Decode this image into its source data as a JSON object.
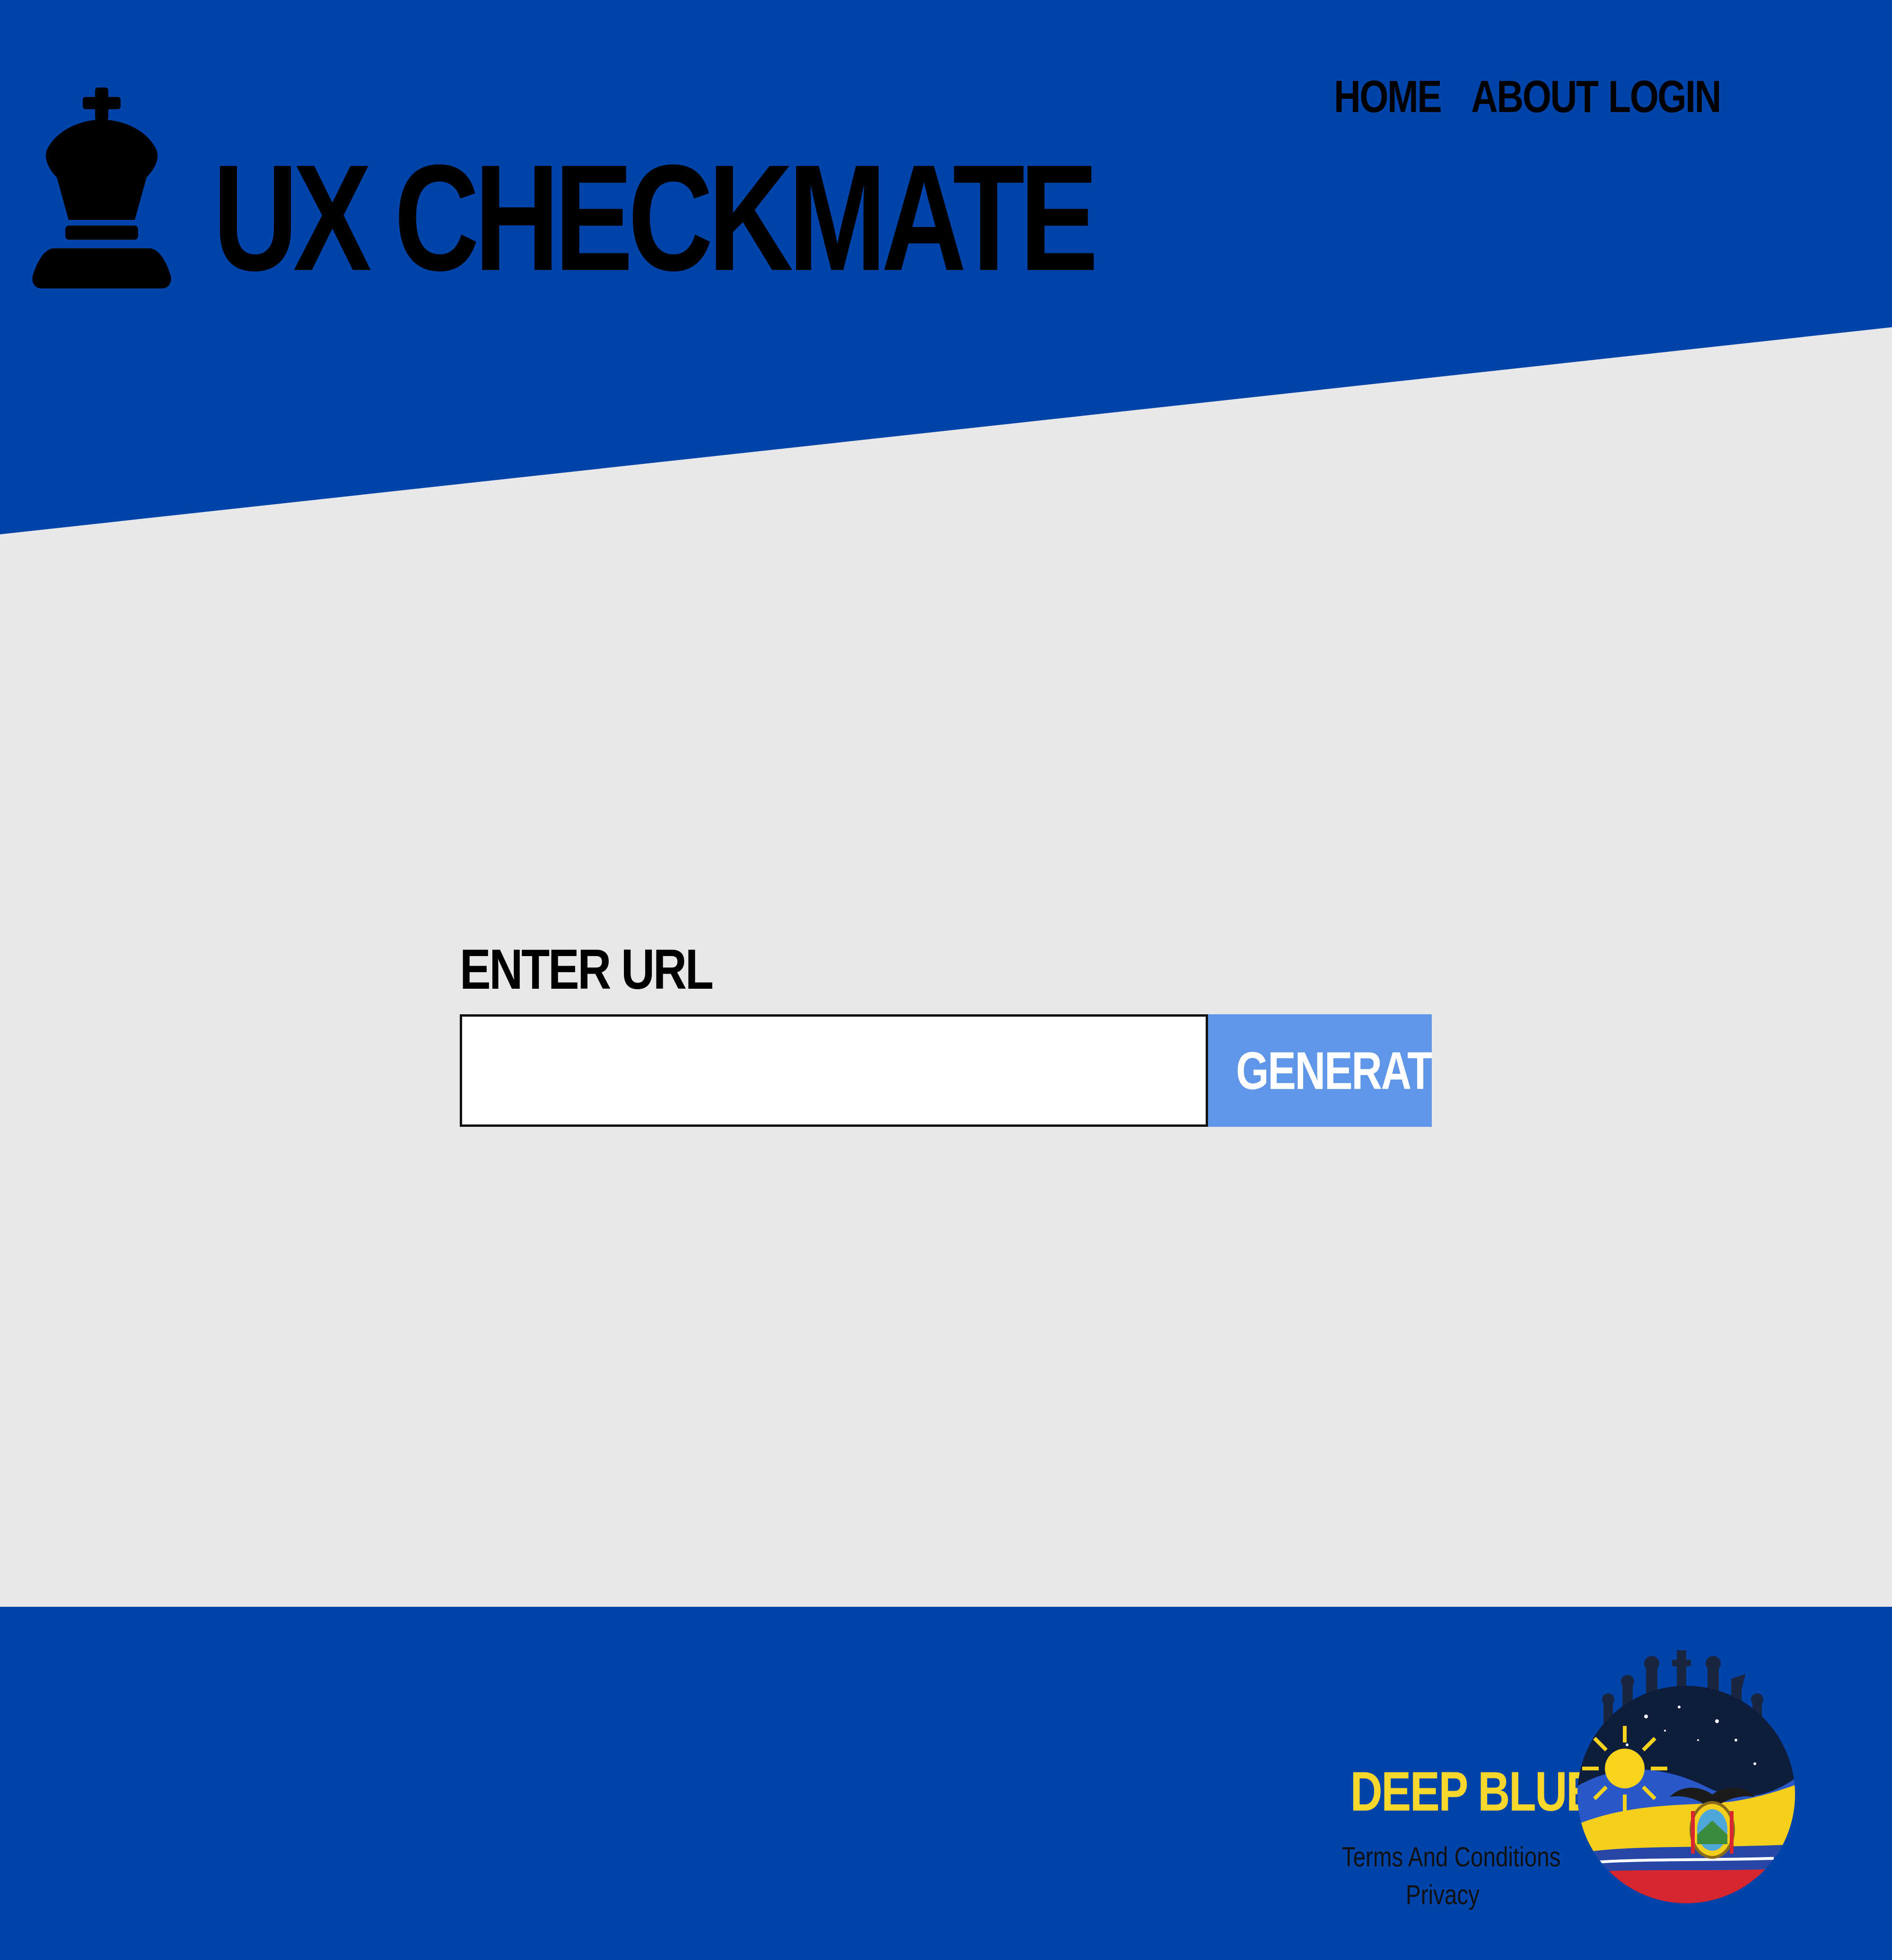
{
  "header": {
    "brand": "UX CHECKMATE",
    "logo_icon": "chess-king-icon",
    "nav": [
      {
        "label": "HOME"
      },
      {
        "label": "ABOUT"
      },
      {
        "label": "LOGIN"
      }
    ]
  },
  "main": {
    "url_label": "ENTER URL",
    "url_input": {
      "value": "",
      "placeholder": ""
    },
    "generate_label": "GENERATE"
  },
  "footer": {
    "brand": "DEEP BLUE",
    "links": [
      {
        "label": "Terms And Conditions"
      },
      {
        "label": "Privacy"
      }
    ],
    "emblem_icon": "team-emblem-icon"
  },
  "colors": {
    "primary_blue": "#0044aa",
    "background": "#e8e7ea",
    "button": "#6096e8",
    "footer_brand": "#f7d72c"
  }
}
